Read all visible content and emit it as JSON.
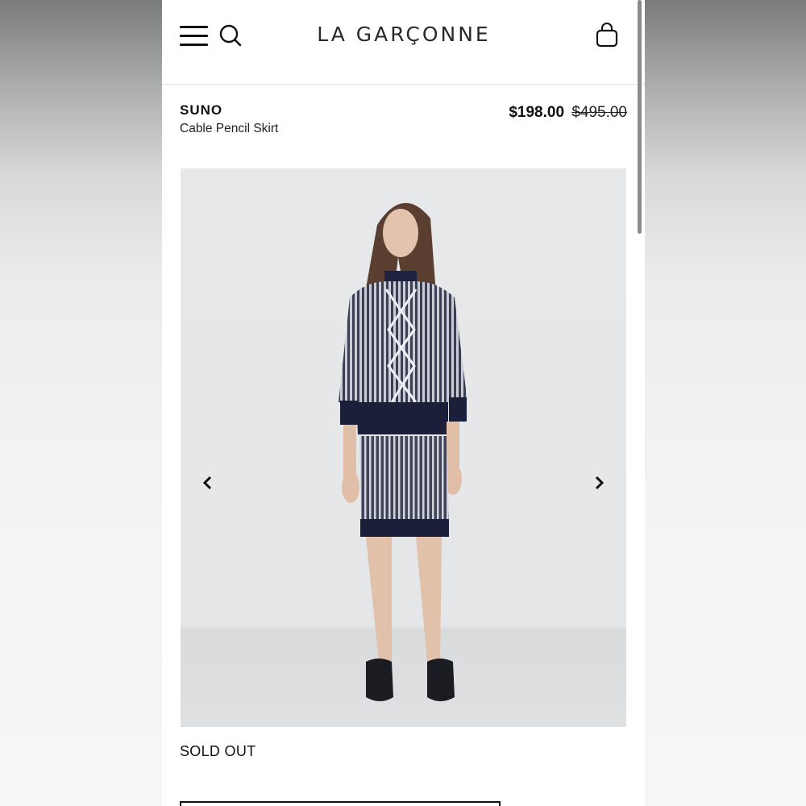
{
  "header": {
    "logo": "LA GARÇONNE",
    "menu_icon": "hamburger-menu-icon",
    "search_icon": "search-icon",
    "bag_icon": "shopping-bag-icon"
  },
  "product": {
    "brand": "SUNO",
    "name": "Cable Pencil Skirt",
    "price_sale": "$198.00",
    "price_original": "$495.00",
    "availability": "SOLD OUT"
  },
  "gallery": {
    "image_subject": "model wearing knit sweater and pencil skirt",
    "prev_icon": "chevron-left-icon",
    "next_icon": "chevron-right-icon"
  },
  "colors": {
    "text": "#111111",
    "background": "#ffffff",
    "gallery_bg": "#e5e7e9"
  }
}
